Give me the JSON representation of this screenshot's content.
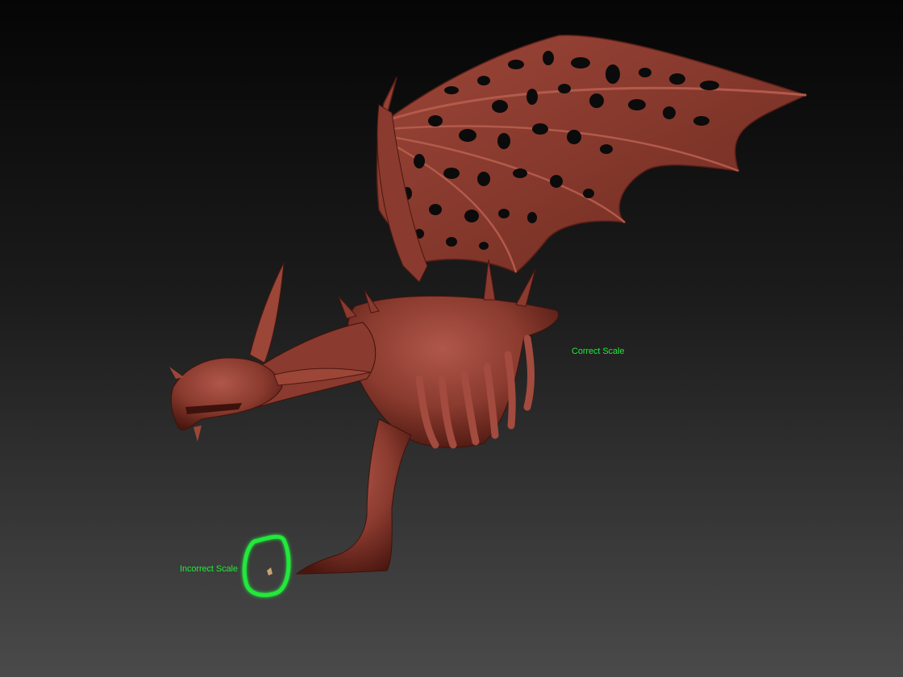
{
  "viewport": {
    "background_top": "#050505",
    "background_bottom": "#4a4a4a",
    "model_name": "dragon-sculpt",
    "model_color": "#8a3a2e",
    "model_highlight": "#b0574a",
    "model_shadow": "#3d120c"
  },
  "annotations": {
    "correct_label": "Correct Scale",
    "incorrect_label": "Incorrect Scale",
    "label_color": "#22e83a",
    "marker_color": "#22e83a"
  }
}
